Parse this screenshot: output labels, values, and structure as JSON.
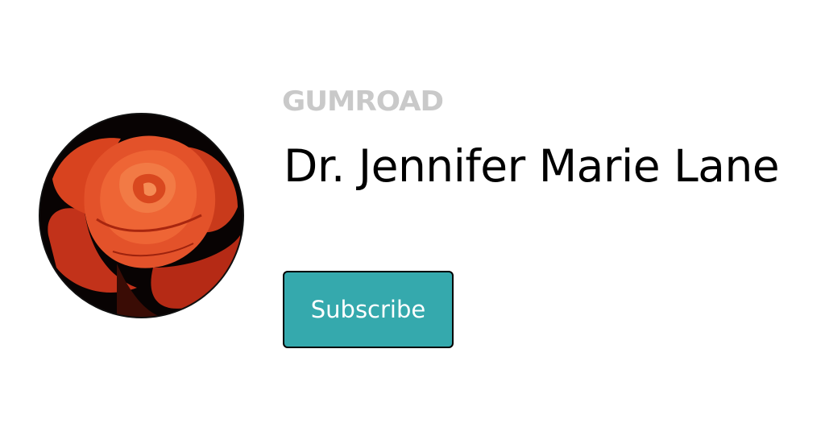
{
  "brand": {
    "logo_text": "GUMROAD",
    "logo_color": "#c9c9c9"
  },
  "profile": {
    "name": "Dr. Jennifer Marie Lane",
    "avatar_alt": "rose-avatar"
  },
  "actions": {
    "subscribe_label": "Subscribe",
    "subscribe_color": "#35a9ad"
  }
}
